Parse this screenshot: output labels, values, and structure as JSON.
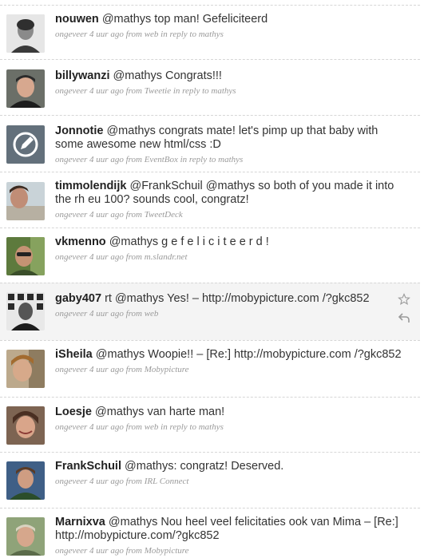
{
  "tweets": [
    {
      "user": "nouwen",
      "text": "@mathys top man! Gefeliciteerd",
      "meta": "ongeveer 4 uur ago from web in reply to mathys",
      "avatar": "avatar-nouwen"
    },
    {
      "user": "billywanzi",
      "text": "@mathys Congrats!!!",
      "meta": "ongeveer 4 uur ago from Tweetie in reply to mathys",
      "avatar": "avatar-billywanzi"
    },
    {
      "user": "Jonnotie",
      "text": "@mathys congrats mate! let's pimp up that baby with some awesome new html/css :D",
      "meta": "ongeveer 4 uur ago from EventBox in reply to mathys",
      "avatar": "avatar-jonnotie"
    },
    {
      "user": "timmolendijk",
      "text": "@FrankSchuil @mathys so both of you made it into the rh eu 100? sounds cool, congratz!",
      "meta": "ongeveer 4 uur ago from TweetDeck",
      "avatar": "avatar-timmolendijk"
    },
    {
      "user": "vkmenno",
      "text": "@mathys g e f e l i c i t e e r d !",
      "meta": "ongeveer 4 uur ago from m.slandr.net",
      "avatar": "avatar-vkmenno"
    },
    {
      "user": "gaby407",
      "text": "rt @mathys Yes! – http://mobypicture.com /?gkc852",
      "meta": "ongeveer 4 uur ago from web",
      "avatar": "avatar-gaby407"
    },
    {
      "user": "iSheila",
      "text": "@mathys Woopie!! – [Re:] http://mobypicture.com /?gkc852",
      "meta": "ongeveer 4 uur ago from Mobypicture",
      "avatar": "avatar-isheila"
    },
    {
      "user": "Loesje",
      "text": "@mathys van harte man!",
      "meta": "ongeveer 4 uur ago from web in reply to mathys",
      "avatar": "avatar-loesje"
    },
    {
      "user": "FrankSchuil",
      "text": "@mathys: congratz! Deserved.",
      "meta": "ongeveer 4 uur ago from IRL Connect",
      "avatar": "avatar-frankschuil"
    },
    {
      "user": "Marnixva",
      "text": "@mathys Nou heel veel felicitaties ook van Mima – [Re:] http://mobypicture.com/?gkc852",
      "meta": "ongeveer 4 uur ago from Mobypicture",
      "avatar": "avatar-marnixva"
    }
  ],
  "colors": {
    "username": "#222222",
    "text": "#333333",
    "meta": "#9a9a9a",
    "highlight": "#f4f4f4"
  },
  "icons": {
    "favorite": "star-icon",
    "reply": "reply-icon"
  }
}
